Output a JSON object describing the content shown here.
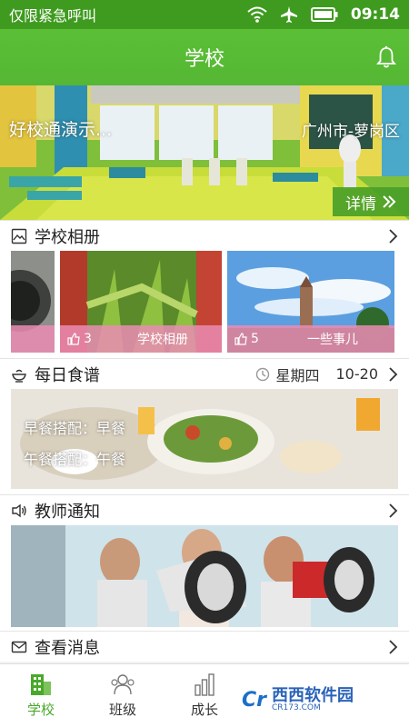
{
  "status": {
    "carrier": "仅限紧急呼叫",
    "time": "09:14",
    "icons": [
      "wifi-icon",
      "airplane-icon",
      "battery-icon"
    ]
  },
  "header": {
    "title": "学校",
    "icon": "bell-icon"
  },
  "banner": {
    "school_name": "好校通演示...",
    "district": "广州市-萝岗区",
    "details_label": "详情"
  },
  "album_section": {
    "title": "学校相册",
    "albums": [
      {
        "likes": "3",
        "name": "学校相册"
      },
      {
        "likes": "5",
        "name": "一些事儿"
      }
    ]
  },
  "menu_section": {
    "title": "每日食谱",
    "weekday": "星期四",
    "date": "10-20",
    "breakfast": "早餐搭配：早餐",
    "lunch": "午餐搭配：午餐"
  },
  "notice_section": {
    "title": "教师通知"
  },
  "messages_section": {
    "title": "查看消息"
  },
  "tabs": [
    {
      "label": "学校",
      "active": true
    },
    {
      "label": "班级",
      "active": false
    },
    {
      "label": "成长",
      "active": false
    }
  ],
  "watermark": {
    "logo": "Cr",
    "brand": "西西软件园",
    "site": "CR173.COM"
  },
  "colors": {
    "primary_green": "#55b734",
    "accent_pink": "#eb8cb4"
  }
}
